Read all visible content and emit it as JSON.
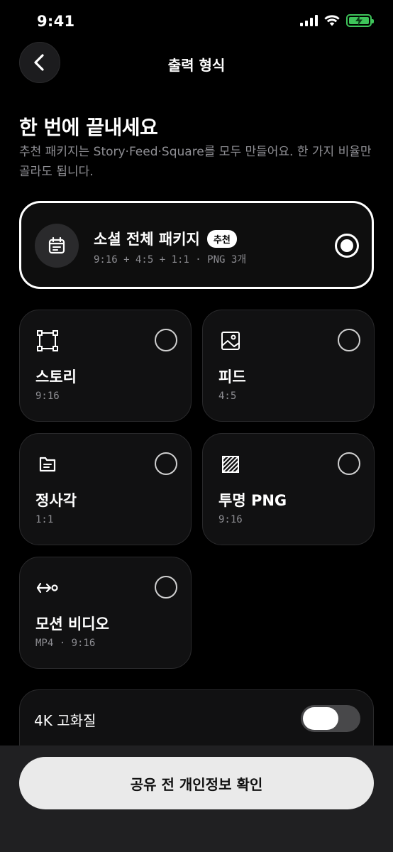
{
  "status_bar": {
    "time": "9:41"
  },
  "header": {
    "title": "출력 형식"
  },
  "hero": {
    "headline": "한 번에 끝내세요",
    "subtitle": "추천 패키지는 Story·Feed·Square를 모두 만들어요. 한 가지 비율만 골라도 됩니다."
  },
  "package": {
    "title": "소셜 전체 패키지",
    "badge": "추천",
    "detail": "9:16 + 4:5 + 1:1 · PNG 3개",
    "selected": true,
    "icon": "calendar-icon"
  },
  "options": [
    {
      "title": "스토리",
      "detail": "9:16",
      "icon": "frame-corners-icon",
      "selected": false
    },
    {
      "title": "피드",
      "detail": "4:5",
      "icon": "image-icon",
      "selected": false
    },
    {
      "title": "정사각",
      "detail": "1:1",
      "icon": "file-text-icon",
      "selected": false
    },
    {
      "title": "투명 PNG",
      "detail": "9:16",
      "icon": "transparent-pattern-icon",
      "selected": false
    },
    {
      "title": "모션 비디오",
      "detail": "MP4 · 9:16",
      "icon": "motion-arrow-icon",
      "selected": false
    }
  ],
  "quality": {
    "label": "4K 고화질",
    "description": "",
    "enabled": false
  },
  "cta": {
    "label": "공유 전 개인정보 확인"
  },
  "colors": {
    "background": "#000000",
    "card": "#111112",
    "battery": "#3ec45a",
    "muted_text": "#8e8e93"
  }
}
